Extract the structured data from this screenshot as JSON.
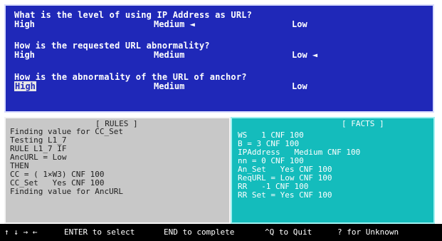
{
  "questions": [
    {
      "text": "What is the level of using IP Address as URL?",
      "options": [
        "High",
        "Medium ◄",
        "Low"
      ],
      "selected": 1
    },
    {
      "text": "How is the requested URL abnormality?",
      "options": [
        "High",
        "Medium",
        "Low ◄"
      ],
      "selected": 2
    },
    {
      "text": "How is the abnormality of the URL of anchor?",
      "options": [
        "High",
        "Medium",
        "Low"
      ],
      "highlighted": 0
    }
  ],
  "rules_panel": {
    "title": "[ RULES ]",
    "lines": [
      "Finding value for CC_Set",
      "Testing L1_7",
      "RULE L1_7 IF",
      "AncURL = Low",
      "THEN",
      "CC = ( 1×W3) CNF 100",
      "CC_Set   Yes CNF 100",
      "Finding value for AncURL"
    ]
  },
  "facts_panel": {
    "title": "[ FACTS ]",
    "lines": [
      "WS   1 CNF 100",
      "B = 3 CNF 100",
      "IPAddress   Medium CNF 100",
      "nn = 0 CNF 100",
      "An_Set   Yes CNF 100",
      "ReqURL = Low CNF 100",
      "RR   -1 CNF 100",
      "RR Set = Yes CNF 100"
    ]
  },
  "status_bar": {
    "arrows": "↑ ↓ → ←",
    "enter": "ENTER to select",
    "end": "END to complete",
    "quit": "^Q to Quit",
    "unknown": "? for Unknown"
  },
  "colors": {
    "question_bg": "#1f28b8",
    "rules_bg": "#c8c8c8",
    "facts_bg": "#14bcbc",
    "status_bg": "#000000"
  }
}
